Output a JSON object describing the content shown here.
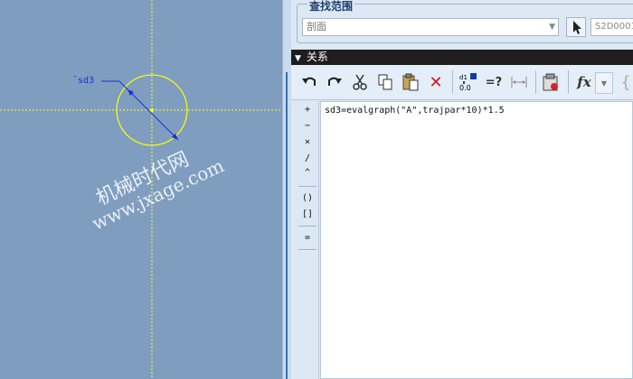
{
  "canvas": {
    "dimension_label": "sd3",
    "watermark_cn": "机械时代网",
    "watermark_url": "www.jxage.com",
    "colors": {
      "background": "#7f9dbf",
      "axis": "#ffff33",
      "dimension": "#1a2fd0"
    }
  },
  "find_scope": {
    "title": "查找范围",
    "scope_value": "剖面",
    "id_value": "S2D0001"
  },
  "relations": {
    "header_title": "关系",
    "expression": "sd3=evalgraph(\"A\",trajpar*10)*1.5"
  },
  "toolbar": {
    "icons": [
      "undo-icon",
      "redo-icon",
      "cut-icon",
      "copy-icon",
      "paste-icon",
      "delete-icon",
      "insert-parameter-icon",
      "evaluate-icon",
      "dimension-icon",
      "verify-icon",
      "function-icon"
    ],
    "evaluate_label": "=?",
    "function_label": "fx"
  },
  "operators": [
    "+",
    "−",
    "×",
    "/",
    "^",
    "()",
    "[]",
    "="
  ]
}
